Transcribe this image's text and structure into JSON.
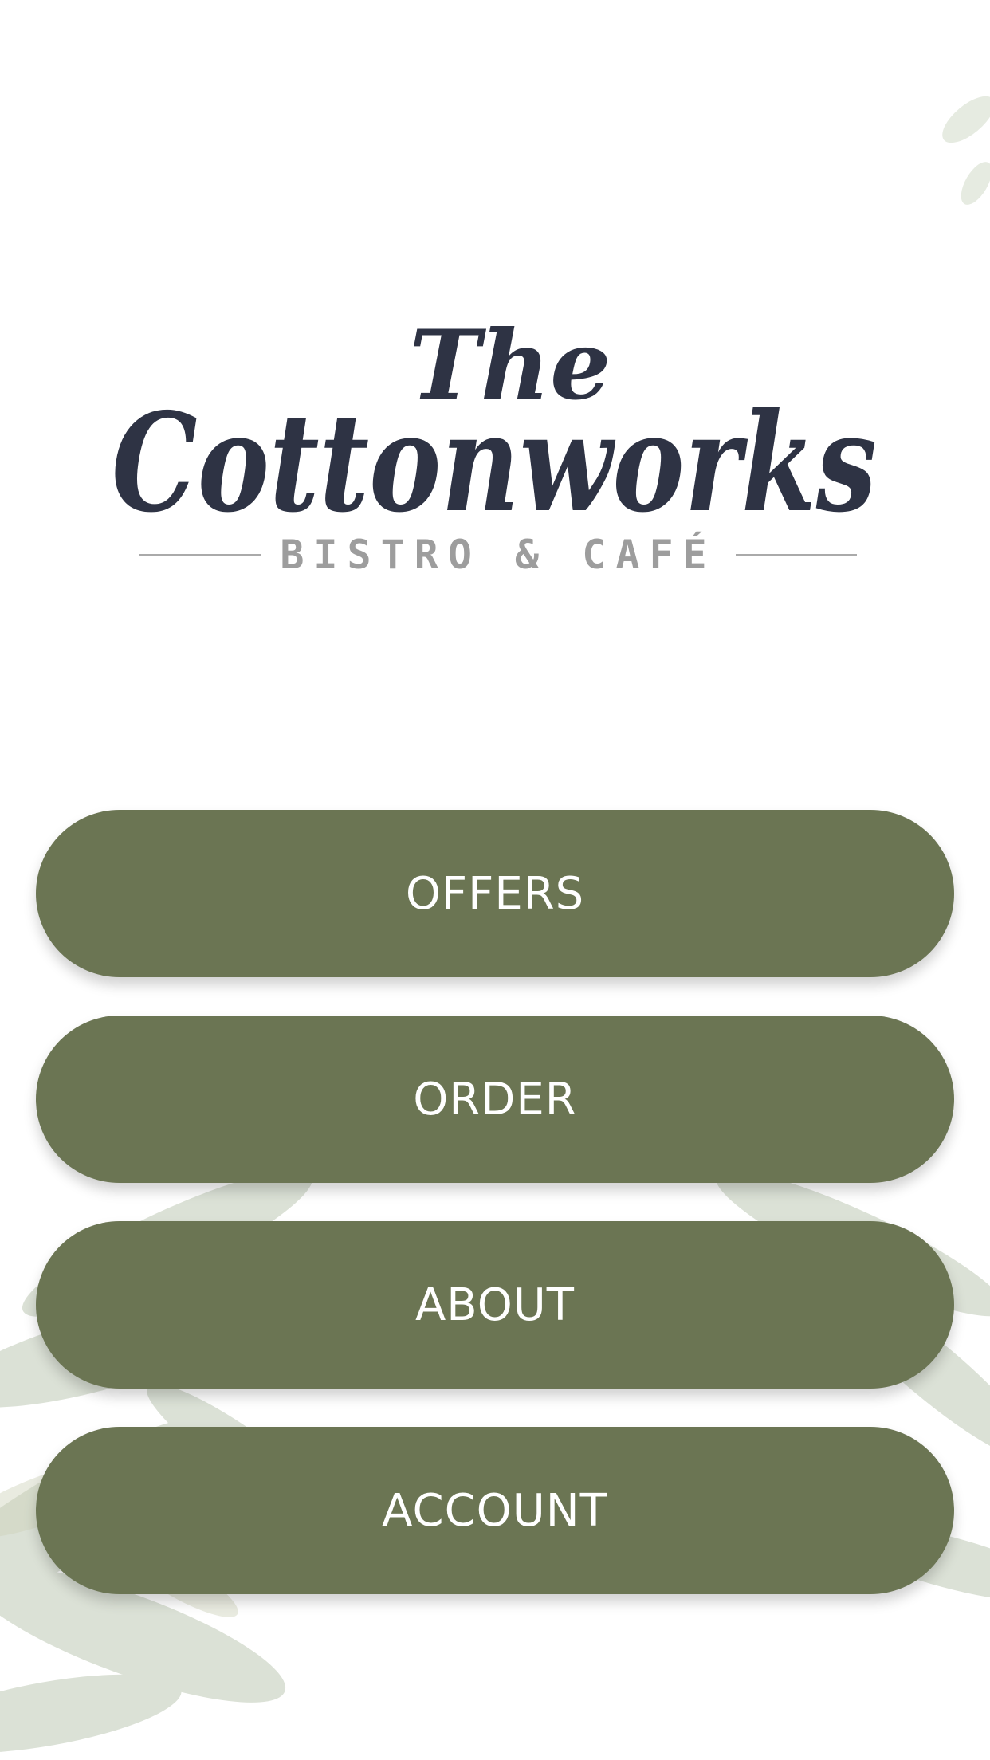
{
  "brand": {
    "logo_script": "The Cottonworks",
    "logo_tagline": "BISTRO & CAFÉ",
    "script_color": "#2e3344",
    "tagline_color": "#9d9d9d"
  },
  "menu": {
    "items": [
      {
        "label": "OFFERS"
      },
      {
        "label": "ORDER"
      },
      {
        "label": "ABOUT"
      },
      {
        "label": "ACCOUNT"
      }
    ],
    "button_color": "#6b7553",
    "text_color": "#ffffff"
  },
  "background": {
    "foliage_color": "#8fa27d"
  }
}
